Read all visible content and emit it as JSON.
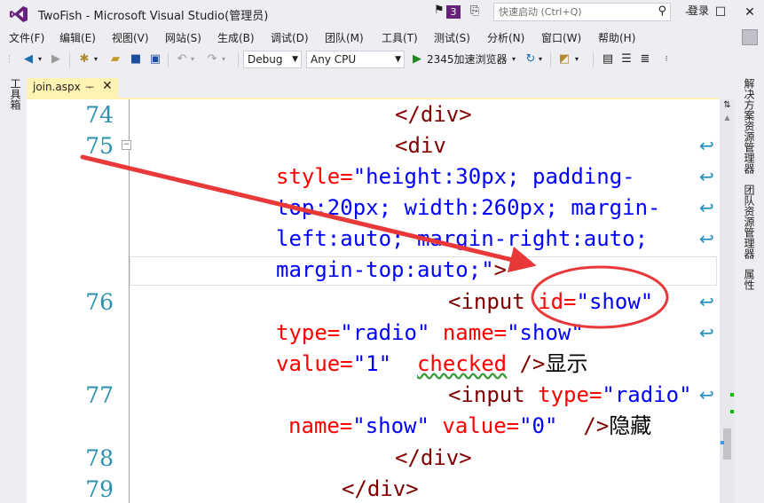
{
  "window": {
    "title": "TwoFish - Microsoft Visual Studio(管理员)",
    "notification_count": "3",
    "quick_launch_placeholder": "快速启动 (Ctrl+Q)",
    "login": "登录"
  },
  "menu": [
    "文件(F)",
    "编辑(E)",
    "视图(V)",
    "网站(S)",
    "生成(B)",
    "调试(D)",
    "团队(M)",
    "工具(T)",
    "测试(S)",
    "分析(N)",
    "窗口(W)",
    "帮助(H)"
  ],
  "toolbar": {
    "configuration": "Debug",
    "platform": "Any CPU",
    "run_target": "2345加速浏览器"
  },
  "side_panels": {
    "left": "工具箱",
    "right": [
      "解决方案资源管理器",
      "团队资源管理器",
      "属性"
    ]
  },
  "tab": {
    "label": "join.aspx",
    "pin": "ᅮ",
    "close": "✕"
  },
  "editor": {
    "line_numbers": [
      "74",
      "75",
      "76",
      "77",
      "78",
      "79"
    ],
    "lines": {
      "l74": "</div>",
      "l75_tag": "<div",
      "l75_w1_attr": "style=",
      "l75_w1_val": "\"height:30px; padding-",
      "l75_w2": "top:20px; width:260px; margin-",
      "l75_w3": "left:auto; margin-right:auto;",
      "l75_w4": "margin-top:auto;\"",
      "l75_w4_close": ">",
      "l76_tag": "<input",
      "l76_attr1": "id=",
      "l76_val1": "\"show\"",
      "l76_w1_attr1": "type=",
      "l76_w1_val1": "\"radio\"",
      "l76_w1_attr2": "name=",
      "l76_w1_val2": "\"show\"",
      "l76_w2_attr1": "value=",
      "l76_w2_val1": "\"1\"",
      "l76_w2_attr2": "checked",
      "l76_w2_close": "/>",
      "l76_w2_text": "显示",
      "l77_tag": "<input",
      "l77_attr1": "type=",
      "l77_val1": "\"radio\"",
      "l77_w1_attr1": "name=",
      "l77_w1_val1": "\"show\"",
      "l77_w1_attr2": "value=",
      "l77_w1_val2": "\"0\"",
      "l77_w1_close": "/>",
      "l77_w1_text": "隐藏",
      "l78": "</div>",
      "l79": "</div>"
    }
  },
  "colors": {
    "tab_active": "#fff3b4",
    "vs_purple": "#68217a",
    "annotation_red": "#e8383a",
    "line_number": "#2b91af",
    "html_tag": "#800000",
    "html_attr": "#ff0000",
    "html_value": "#0000ff"
  }
}
